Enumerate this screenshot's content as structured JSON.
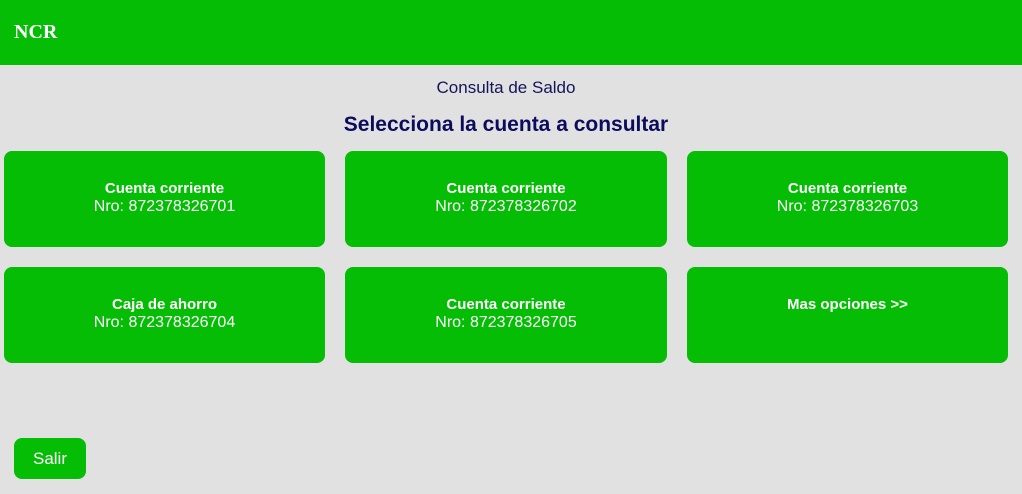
{
  "header": {
    "logo": "NCR"
  },
  "page": {
    "subtitle": "Consulta de Saldo",
    "heading": "Selecciona la cuenta a consultar"
  },
  "accounts": [
    {
      "type": "Cuenta corriente",
      "number": "Nro: 872378326701"
    },
    {
      "type": "Cuenta corriente",
      "number": "Nro: 872378326702"
    },
    {
      "type": "Cuenta corriente",
      "number": "Nro: 872378326703"
    },
    {
      "type": "Caja de ahorro",
      "number": "Nro: 872378326704"
    },
    {
      "type": "Cuenta corriente",
      "number": "Nro: 872378326705"
    }
  ],
  "more_options": {
    "label": "Mas opciones >>"
  },
  "footer": {
    "exit_label": "Salir"
  },
  "colors": {
    "brand_green": "#06bd06",
    "background": "#e1e1e1",
    "heading_text": "#0c0c5e",
    "tile_text": "#ffffff"
  }
}
